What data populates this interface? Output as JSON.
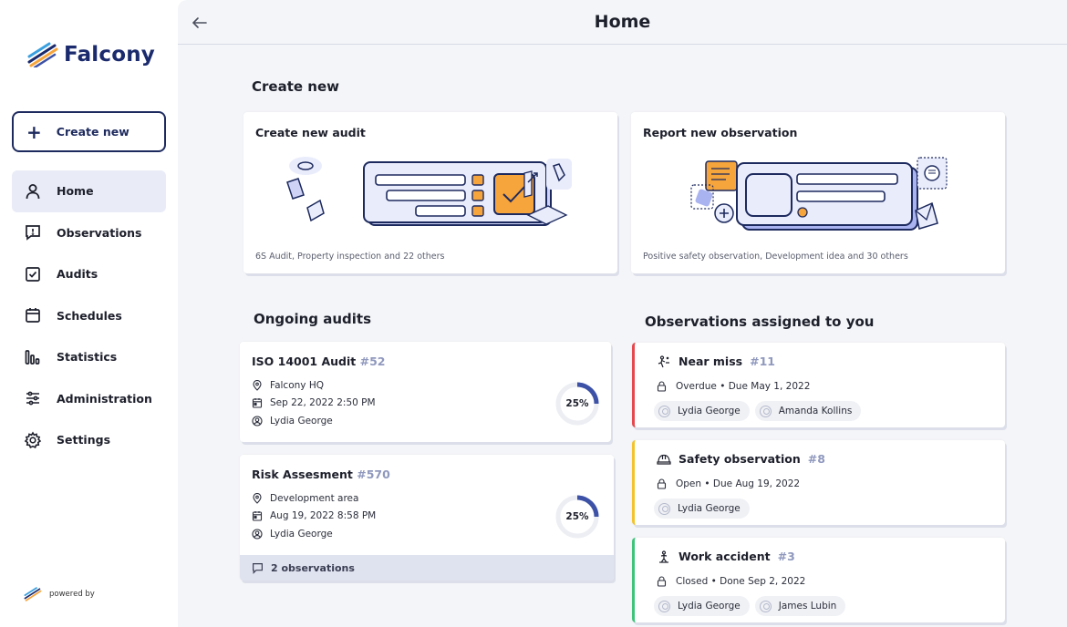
{
  "app": {
    "brand": "Falcony",
    "powered_by": "powered by"
  },
  "sidebar": {
    "create_label": "Create new",
    "items": [
      {
        "label": "Home",
        "icon": "user-icon",
        "active": true
      },
      {
        "label": "Observations",
        "icon": "message-alert-icon"
      },
      {
        "label": "Audits",
        "icon": "checkbox-icon"
      },
      {
        "label": "Schedules",
        "icon": "calendar-icon"
      },
      {
        "label": "Statistics",
        "icon": "bar-chart-icon"
      },
      {
        "label": "Administration",
        "icon": "sliders-icon"
      },
      {
        "label": "Settings",
        "icon": "gear-icon"
      }
    ]
  },
  "header": {
    "title": "Home"
  },
  "create_section": {
    "title": "Create new",
    "audit_card": {
      "title": "Create new audit",
      "subtitle": "6S Audit, Property inspection and 22 others"
    },
    "observation_card": {
      "title": "Report new observation",
      "subtitle": "Positive safety observation, Development idea and 30 others"
    }
  },
  "ongoing": {
    "title": "Ongoing audits",
    "audits": [
      {
        "title": "ISO 14001 Audit",
        "number": "#52",
        "location": "Falcony HQ",
        "date": "Sep 22, 2022 2:50 PM",
        "person": "Lydia George",
        "progress_label": "25%",
        "progress": 0.25
      },
      {
        "title": "Risk Assesment",
        "number": "#570",
        "location": "Development area",
        "date": "Aug 19, 2022 8:58 PM",
        "person": "Lydia George",
        "progress_label": "25%",
        "progress": 0.25,
        "footer": "2 observations"
      }
    ]
  },
  "assigned": {
    "title": "Observations assigned to you",
    "items": [
      {
        "title": "Near miss",
        "number": "#11",
        "status": "Overdue • Due May 1, 2022",
        "color": "#e5484d",
        "people": [
          "Lydia George",
          "Amanda Kollins"
        ]
      },
      {
        "title": "Safety observation",
        "number": "#8",
        "status": "Open • Due Aug 19, 2022",
        "color": "#f2c32c",
        "people": [
          "Lydia George"
        ]
      },
      {
        "title": "Work accident",
        "number": "#3",
        "status": "Closed • Done Sep 2, 2022",
        "color": "#3ec47a",
        "people": [
          "Lydia George",
          "James Lubin"
        ]
      }
    ]
  },
  "colors": {
    "accent": "#1d2a5e",
    "progress": "#3d52a6",
    "illustration_orange": "#f6a43c",
    "illustration_purple": "#cfd4f7"
  }
}
